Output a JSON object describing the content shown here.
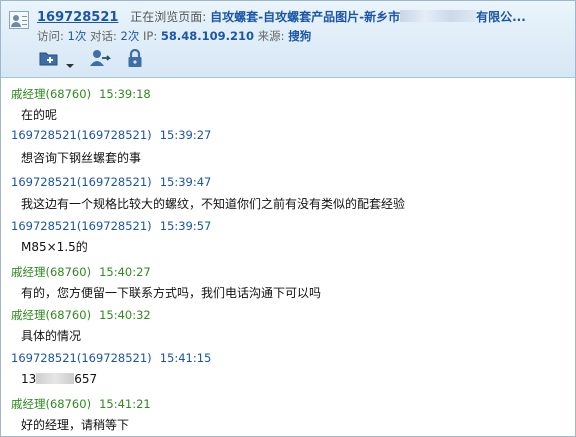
{
  "header": {
    "visitor_id": "169728521",
    "browsing_label": "正在浏览页面:",
    "page_title_start": "自攻螺套-自攻螺套产品图片-新乡市",
    "page_title_end": "有限公...",
    "visits_label": "访问:",
    "visits_value": "1次",
    "dialogs_label": "对话:",
    "dialogs_value": "2次",
    "ip_label": "IP:",
    "ip_value": "58.48.109.210",
    "source_label": "来源:",
    "source_value": "搜狗"
  },
  "toolbar": {
    "icons": [
      "add-folder-icon",
      "dropdown-arrow-icon",
      "transfer-user-icon",
      "lock-icon"
    ]
  },
  "messages": [
    {
      "sender": "戚经理(68760)",
      "role": "staff",
      "time": "15:39:18",
      "text": "在的呢"
    },
    {
      "sender": "169728521(169728521)",
      "role": "visitor",
      "time": "15:39:27",
      "text": "想咨询下钢丝螺套的事"
    },
    {
      "sender": "169728521(169728521)",
      "role": "visitor",
      "time": "15:39:47",
      "text": "我这边有一个规格比较大的螺纹，不知道你们之前有没有类似的配套经验"
    },
    {
      "sender": "169728521(169728521)",
      "role": "visitor",
      "time": "15:39:57",
      "text": "M85×1.5的"
    },
    {
      "sender": "戚经理(68760)",
      "role": "staff",
      "time": "15:40:27",
      "text": "有的，您方便留一下联系方式吗，我们电话沟通下可以吗"
    },
    {
      "sender": "戚经理(68760)",
      "role": "staff",
      "time": "15:40:32",
      "text": "具体的情况"
    },
    {
      "sender": "169728521(169728521)",
      "role": "visitor",
      "time": "15:41:15",
      "text_start": "13",
      "text_end": "657"
    },
    {
      "sender": "戚经理(68760)",
      "role": "staff",
      "time": "15:41:21",
      "text": "好的经理，请稍等下"
    }
  ],
  "colors": {
    "staff": "#2f8a1e",
    "visitor": "#1a55a3",
    "header_bg": "#d6e7f5"
  }
}
